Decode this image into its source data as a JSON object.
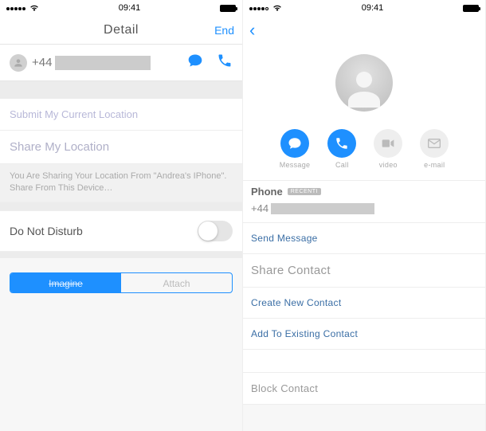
{
  "status": {
    "time": "09:41"
  },
  "left": {
    "nav": {
      "title": "Detail",
      "right": "End"
    },
    "phone_prefix": "+44",
    "submit_location": "Submit My Current Location",
    "share_location": "Share My Location",
    "sharing_note": "You Are Sharing Your Location From \"Andrea's IPhone\". Share From This Device…",
    "dnd": "Do Not Disturb",
    "seg": {
      "active": "Imagine",
      "inactive": "Attach"
    }
  },
  "right": {
    "actions": {
      "message": "Message",
      "call": "Call",
      "video": "video",
      "email": "e-mail"
    },
    "phone_label": "Phone",
    "badge": "RECENTI",
    "phone_prefix": "+44",
    "send_message": "Send Message",
    "share_contact": "Share Contact",
    "create_contact": "Create New Contact",
    "add_existing": "Add To Existing Contact",
    "block": "Block Contact"
  }
}
